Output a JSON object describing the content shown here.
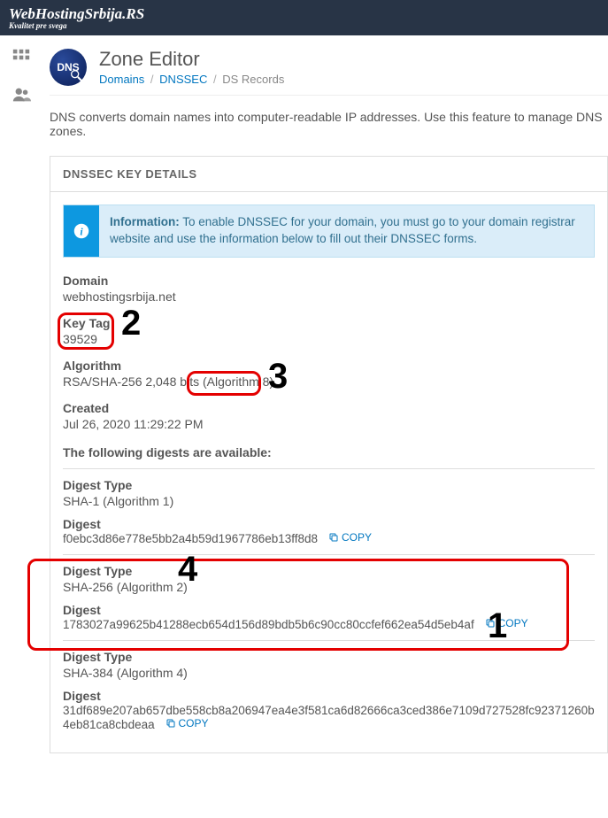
{
  "brand": {
    "name": "WebHostingSrbija.RS",
    "tagline": "Kvalitet pre svega"
  },
  "header": {
    "title": "Zone Editor",
    "breadcrumb": {
      "domains": "Domains",
      "dnssec": "DNSSEC",
      "current": "DS Records"
    }
  },
  "intro": "DNS converts domain names into computer-readable IP addresses. Use this feature to manage DNS zones.",
  "panel": {
    "title": "DNSSEC KEY DETAILS",
    "callout": {
      "strong": "Information:",
      "text": " To enable DNSSEC for your domain, you must go to your domain registrar website and use the information below to fill out their DNSSEC forms."
    },
    "fields": {
      "domain_label": "Domain",
      "domain_value": "webhostingsrbija.net",
      "keytag_label": "Key Tag",
      "keytag_value": "39529",
      "algorithm_label": "Algorithm",
      "algorithm_value": "RSA/SHA-256 2,048 bits (Algorithm 8)",
      "created_label": "Created",
      "created_value": "Jul 26, 2020 11:29:22 PM"
    },
    "digests_title": "The following digests are available:",
    "digest_type_label": "Digest Type",
    "digest_label": "Digest",
    "copy_label": "COPY",
    "digests": [
      {
        "type": "SHA-1 (Algorithm 1)",
        "value": "f0ebc3d86e778e5bb2a4b59d1967786eb13ff8d8"
      },
      {
        "type": "SHA-256 (Algorithm 2)",
        "value": "1783027a99625b41288ecb654d156d89bdb5b6c90cc80ccfef662ea54d5eb4af"
      },
      {
        "type": "SHA-384 (Algorithm 4)",
        "value": "31df689e207ab657dbe558cb8a206947ea4e3f581ca6d82666ca3ced386e7109d727528fc92371260b4eb81ca8cbdeaa"
      }
    ]
  },
  "annotations": {
    "n1": "1",
    "n2": "2",
    "n3": "3",
    "n4": "4"
  }
}
